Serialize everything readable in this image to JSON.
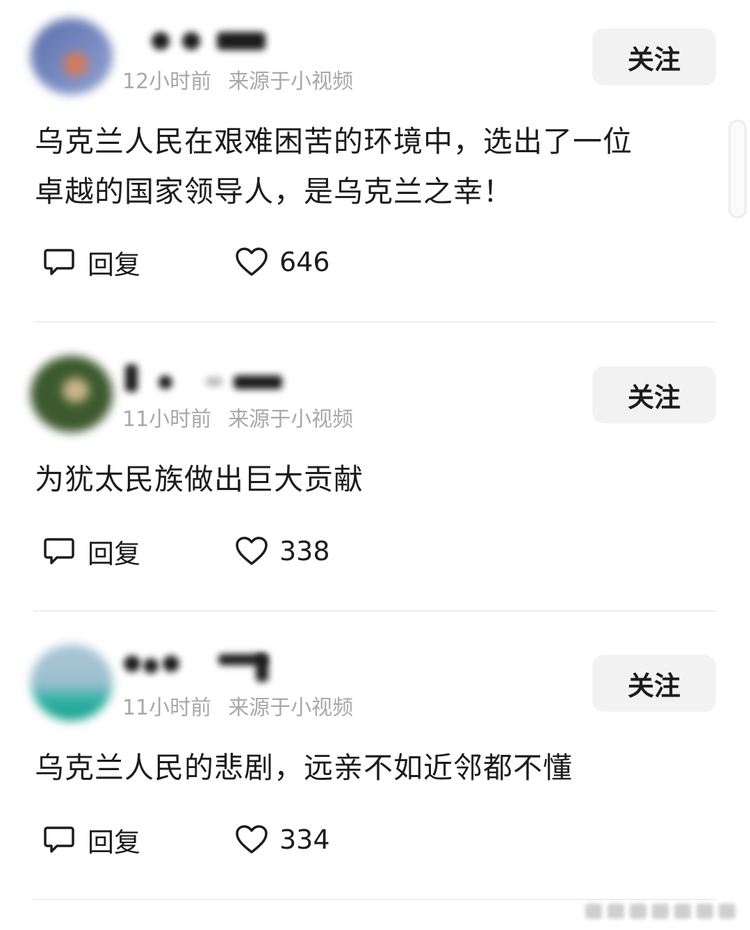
{
  "follow_label": "关注",
  "reply_label": "回复",
  "comments": [
    {
      "time": "12小时前",
      "source": "来源于小视频",
      "text_line1": "乌克兰人民在艰难困苦的环境中，选出了一位",
      "text_line2": "卓越的国家领导人，是乌克兰之幸！",
      "likes": "646",
      "avatar_color": "#6b7fb8"
    },
    {
      "time": "11小时前",
      "source": "来源于小视频",
      "text_line1": "为犹太民族做出巨大贡献",
      "likes": "338",
      "avatar_color": "#3d5a2e"
    },
    {
      "time": "11小时前",
      "source": "来源于小视频",
      "text_line1": "乌克兰人民的悲剧，远亲不如近邻都不懂",
      "likes": "334",
      "avatar_color": "#2ab0a0"
    }
  ],
  "icons": {
    "reply": "comment-bubble-icon",
    "like": "heart-icon"
  }
}
